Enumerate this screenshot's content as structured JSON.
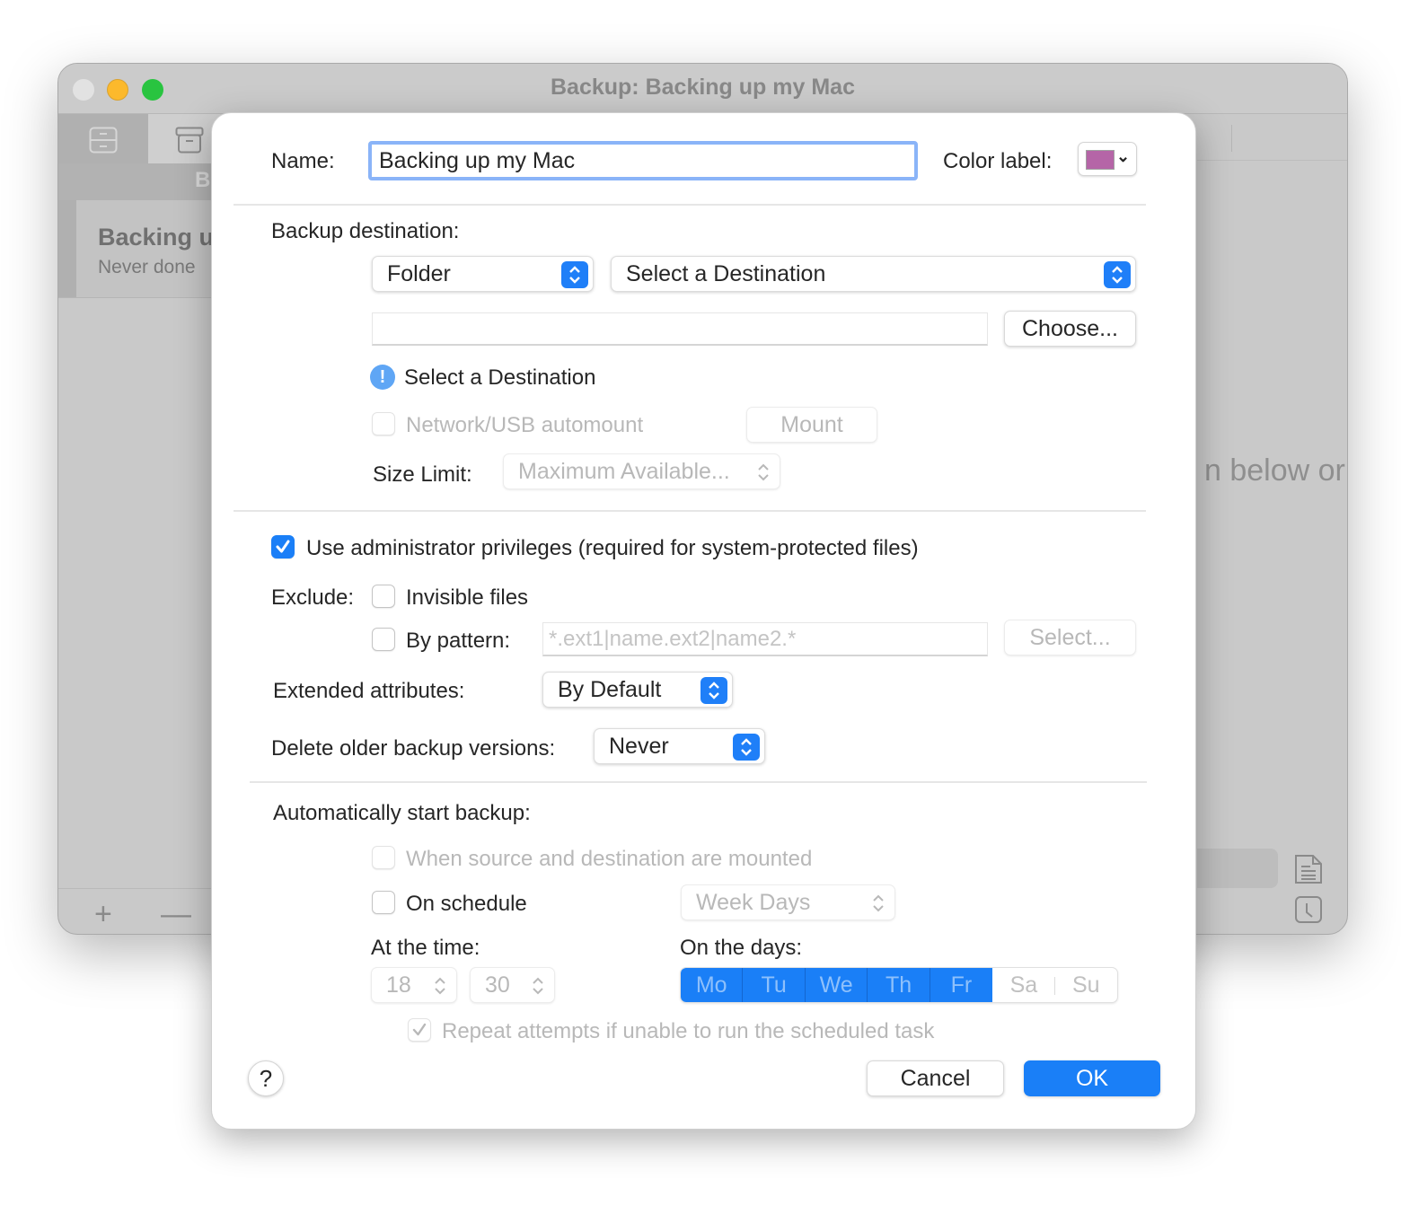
{
  "window": {
    "title": "Backup: Backing up my Mac",
    "sidebar_header_partial": "B",
    "sidebar_item": {
      "name": "Backing up my Mac",
      "status": "Never done"
    },
    "background_hint_partial": "n below or",
    "add_label": "+",
    "remove_label": "—"
  },
  "dialog": {
    "name_label": "Name:",
    "name_value": "Backing up my Mac",
    "color_label": "Color label:",
    "color_value": "#b565a7",
    "backup_destination_label": "Backup destination:",
    "destination_type": "Folder",
    "destination_select": "Select a Destination",
    "destination_path": "",
    "choose_button": "Choose...",
    "status_message": "Select a Destination",
    "network_automount_label": "Network/USB automount",
    "network_automount_checked": false,
    "mount_button": "Mount",
    "size_limit_label": "Size Limit:",
    "size_limit_value": "Maximum Available...",
    "admin_privileges_label": "Use administrator privileges (required for system-protected files)",
    "admin_privileges_checked": true,
    "exclude_label": "Exclude:",
    "invisible_files_label": "Invisible files",
    "invisible_files_checked": false,
    "by_pattern_label": "By pattern:",
    "by_pattern_checked": false,
    "pattern_placeholder": "*.ext1|name.ext2|name2.*",
    "select_button": "Select...",
    "extended_attributes_label": "Extended attributes:",
    "extended_attributes_value": "By Default",
    "delete_older_label": "Delete older backup versions:",
    "delete_older_value": "Never",
    "auto_start_label": "Automatically start backup:",
    "when_mounted_label": "When source and destination are mounted",
    "when_mounted_checked": false,
    "on_schedule_label": "On schedule",
    "on_schedule_checked": false,
    "schedule_frequency": "Week Days",
    "at_time_label": "At the time:",
    "hour": "18",
    "minute": "30",
    "on_days_label": "On the days:",
    "days": [
      {
        "label": "Mo",
        "selected": true
      },
      {
        "label": "Tu",
        "selected": true
      },
      {
        "label": "We",
        "selected": true
      },
      {
        "label": "Th",
        "selected": true
      },
      {
        "label": "Fr",
        "selected": true
      },
      {
        "label": "Sa",
        "selected": false
      },
      {
        "label": "Su",
        "selected": false
      }
    ],
    "repeat_attempts_label": "Repeat attempts if unable to run the scheduled task",
    "repeat_attempts_checked": true,
    "help_button": "?",
    "cancel_button": "Cancel",
    "ok_button": "OK"
  },
  "colors": {
    "accent": "#1a7ff7",
    "focus_ring": "#8ab4f8",
    "info_icon": "#5fa6f5"
  }
}
